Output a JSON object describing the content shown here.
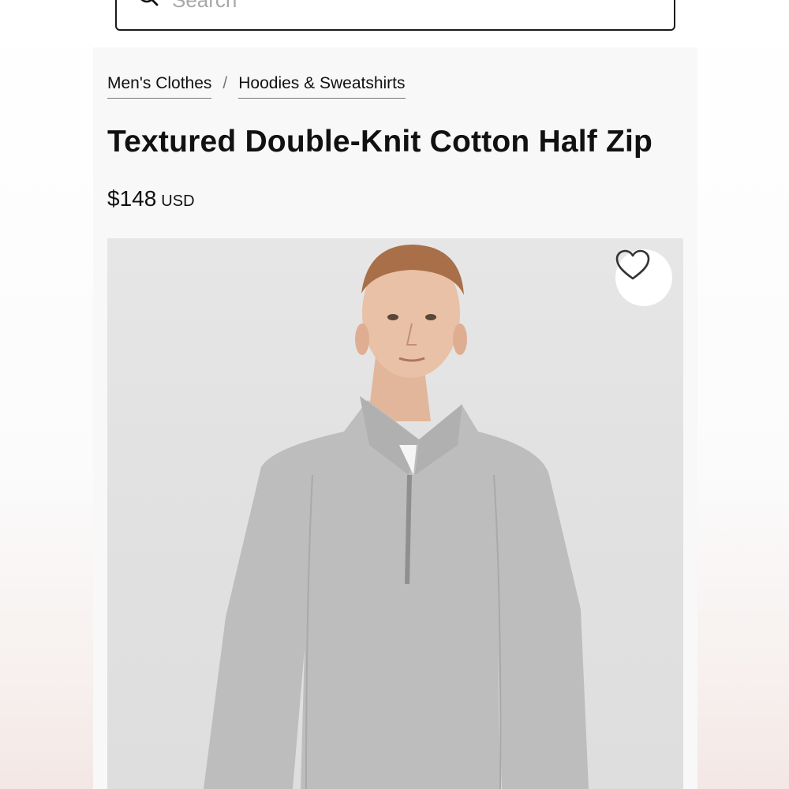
{
  "search": {
    "placeholder": "Search"
  },
  "breadcrumb": {
    "items": [
      {
        "label": "Men's Clothes"
      },
      {
        "label": "Hoodies & Sweatshirts"
      }
    ],
    "separator": "/"
  },
  "product": {
    "title": "Textured Double-Knit Cotton Half Zip",
    "price": "$148",
    "currency": "USD",
    "image_alt_icon": "heart-icon"
  },
  "colors": {
    "text": "#111111",
    "background": "#f8f8f8",
    "image_background": "#e3e3e3",
    "sweater": "#b9b9b9"
  }
}
